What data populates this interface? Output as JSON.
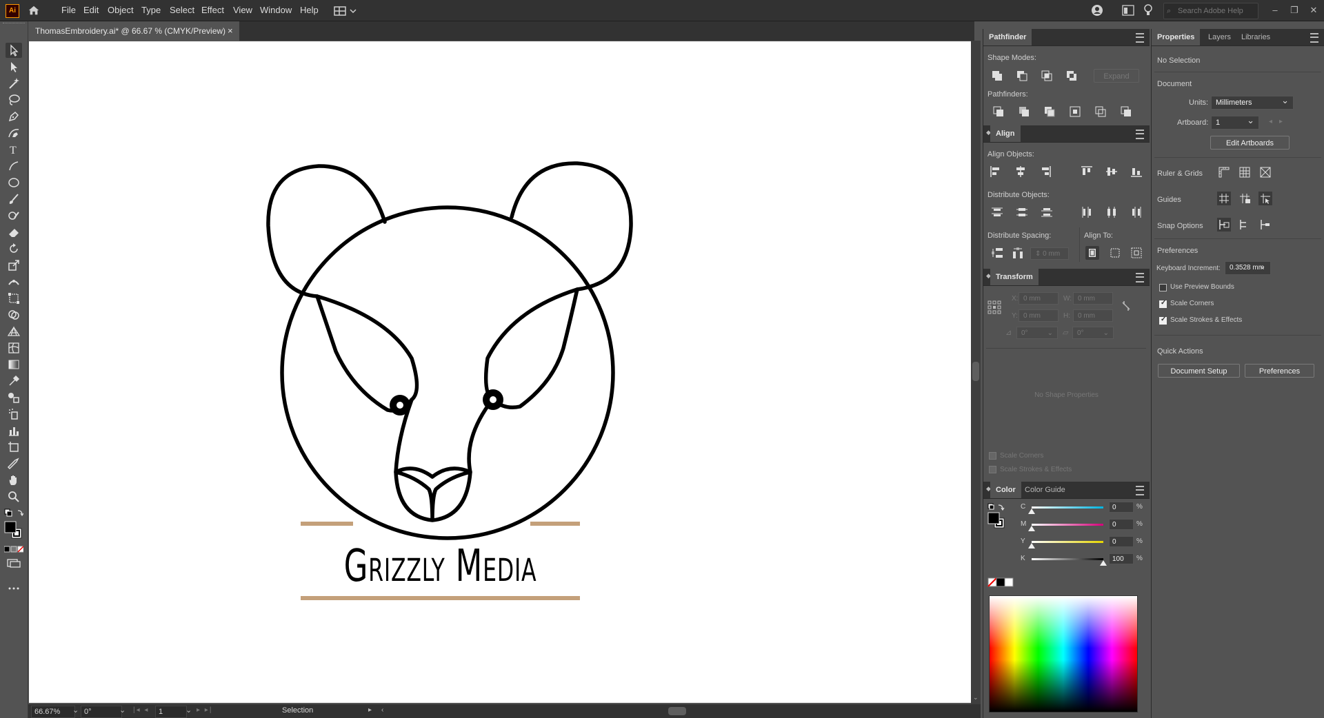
{
  "menubar": {
    "app_logo": "Ai",
    "items": [
      "File",
      "Edit",
      "Object",
      "Type",
      "Select",
      "Effect",
      "View",
      "Window",
      "Help"
    ],
    "search_placeholder": "Search Adobe Help"
  },
  "document": {
    "tab_title": "ThomasEmbroidery.ai* @ 66.67 % (CMYK/Preview)",
    "close_glyph": "×"
  },
  "artwork": {
    "text": "Grizzly Media",
    "line_color": "#c4a07a",
    "stroke_color": "#000000"
  },
  "statusbar": {
    "zoom": "66.67%",
    "rotation": "0°",
    "artboard": "1",
    "tool": "Selection"
  },
  "pathfinder": {
    "tab": "Pathfinder",
    "shape_modes_label": "Shape Modes:",
    "expand_label": "Expand",
    "pathfinders_label": "Pathfinders:"
  },
  "align": {
    "tab": "Align",
    "align_objects_label": "Align Objects:",
    "distribute_objects_label": "Distribute Objects:",
    "distribute_spacing_label": "Distribute Spacing:",
    "align_to_label": "Align To:",
    "spacing_value": "0 mm"
  },
  "transform": {
    "tab": "Transform",
    "x_label": "X:",
    "x_value": "0 mm",
    "y_label": "Y:",
    "y_value": "0 mm",
    "w_label": "W:",
    "w_value": "0 mm",
    "h_label": "H:",
    "h_value": "0 mm",
    "angle_value": "0°",
    "shear_value": "0°",
    "no_shape": "No Shape Properties",
    "scale_corners": "Scale Corners",
    "scale_strokes": "Scale Strokes & Effects"
  },
  "color": {
    "tab": "Color",
    "guide_tab": "Color Guide",
    "channels": [
      {
        "label": "C",
        "value": "0",
        "pct": "%",
        "fraction": 0,
        "color": "#00b4e0"
      },
      {
        "label": "M",
        "value": "0",
        "pct": "%",
        "fraction": 0,
        "color": "#d6007a"
      },
      {
        "label": "Y",
        "value": "0",
        "pct": "%",
        "fraction": 0,
        "color": "#e6d600"
      },
      {
        "label": "K",
        "value": "100",
        "pct": "%",
        "fraction": 1,
        "color": "#000000"
      }
    ]
  },
  "properties": {
    "tabs": [
      "Properties",
      "Layers",
      "Libraries"
    ],
    "selection": "No Selection",
    "document_label": "Document",
    "units_label": "Units:",
    "units_value": "Millimeters",
    "artboard_label": "Artboard:",
    "artboard_value": "1",
    "edit_artboards": "Edit Artboards",
    "ruler_grids": "Ruler & Grids",
    "guides": "Guides",
    "snap_options": "Snap Options",
    "preferences_label": "Preferences",
    "keyboard_increment_label": "Keyboard Increment:",
    "keyboard_increment_value": "0.3528 mm",
    "use_preview_bounds": "Use Preview Bounds",
    "scale_corners": "Scale Corners",
    "scale_strokes": "Scale Strokes & Effects",
    "quick_actions": "Quick Actions",
    "document_setup": "Document Setup",
    "preferences_button": "Preferences"
  }
}
